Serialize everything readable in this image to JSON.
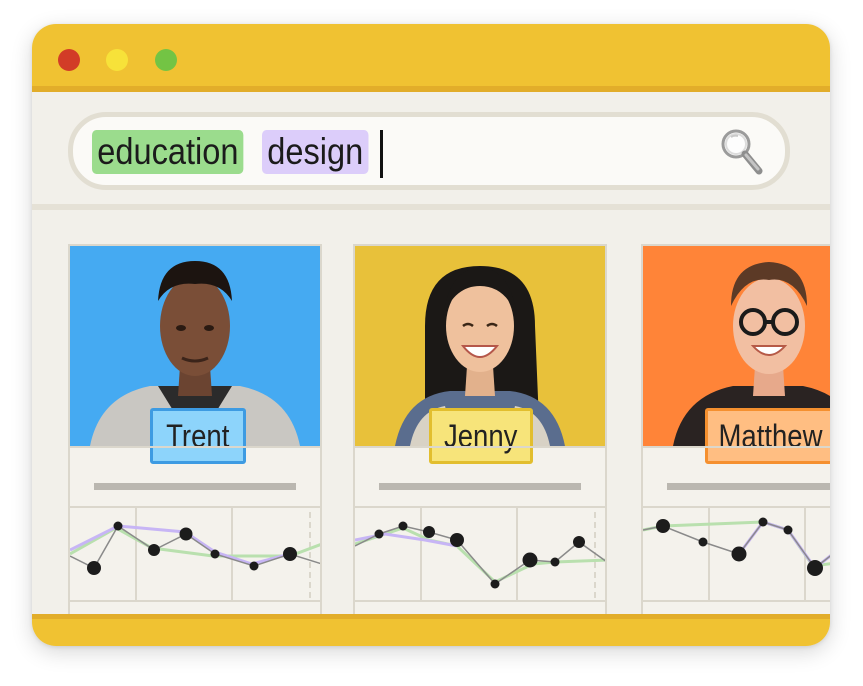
{
  "window": {
    "controls": [
      "close",
      "minimize",
      "maximize"
    ]
  },
  "search": {
    "tags": [
      {
        "label": "education",
        "color": "#9bdc8d"
      },
      {
        "label": "design",
        "color": "#dccdfa"
      }
    ],
    "icon": "magnifying-glass-icon"
  },
  "cards": [
    {
      "name": "Trent",
      "photo_bg": "#45aaf2",
      "label_bg": "#8dd4fb",
      "label_border": "#3d9be2"
    },
    {
      "name": "Jenny",
      "photo_bg": "#e8c13a",
      "label_bg": "#f7e47a",
      "label_border": "#e2be2e"
    },
    {
      "name": "Matthew",
      "photo_bg": "#ff8438",
      "label_bg": "#ffbe82",
      "label_border": "#f5902f"
    }
  ],
  "colors": {
    "accent": "#f0c232",
    "green_line": "#b9e0ae",
    "purple_line": "#c7b5f5"
  }
}
